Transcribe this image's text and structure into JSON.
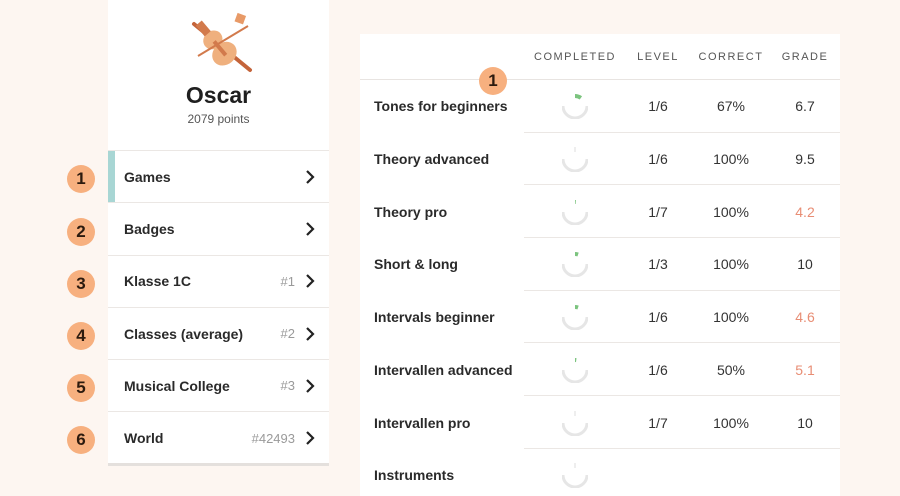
{
  "profile": {
    "name": "Oscar",
    "points": "2079 points",
    "avatar_icon": "violin-icon"
  },
  "menu": [
    {
      "label": "Games",
      "rank": "",
      "active": true
    },
    {
      "label": "Badges",
      "rank": "",
      "active": false
    },
    {
      "label": "Klasse 1C",
      "rank": "#1",
      "active": false
    },
    {
      "label": "Classes (average)",
      "rank": "#2",
      "active": false
    },
    {
      "label": "Musical College",
      "rank": "#3",
      "active": false
    },
    {
      "label": "World",
      "rank": "#42493",
      "active": false
    }
  ],
  "steps": [
    "1",
    "2",
    "3",
    "4",
    "5",
    "6"
  ],
  "table_step": "1",
  "table": {
    "headers": {
      "completed": "COMPLETED",
      "level": "LEVEL",
      "correct": "CORRECT",
      "grade": "GRADE"
    },
    "rows": [
      {
        "name": "Tones for beginners",
        "completed_fraction": 0.1,
        "level": "1/6",
        "correct": "67%",
        "grade": "6.7",
        "grade_low": false
      },
      {
        "name": "Theory advanced",
        "completed_fraction": 0.0,
        "level": "1/6",
        "correct": "100%",
        "grade": "9.5",
        "grade_low": false
      },
      {
        "name": "Theory pro",
        "completed_fraction": 0.01,
        "level": "1/7",
        "correct": "100%",
        "grade": "4.2",
        "grade_low": true
      },
      {
        "name": "Short & long",
        "completed_fraction": 0.05,
        "level": "1/3",
        "correct": "100%",
        "grade": "10",
        "grade_low": false
      },
      {
        "name": "Intervals beginner",
        "completed_fraction": 0.05,
        "level": "1/6",
        "correct": "100%",
        "grade": "4.6",
        "grade_low": true
      },
      {
        "name": "Intervallen advanced",
        "completed_fraction": 0.02,
        "level": "1/6",
        "correct": "50%",
        "grade": "5.1",
        "grade_low": true
      },
      {
        "name": "Intervallen pro",
        "completed_fraction": 0.0,
        "level": "1/7",
        "correct": "100%",
        "grade": "10",
        "grade_low": false
      },
      {
        "name": "Instruments",
        "completed_fraction": 0.0,
        "level": "",
        "correct": "",
        "grade": "",
        "grade_low": false
      }
    ]
  },
  "colors": {
    "accent_teal": "#a8d6d4",
    "badge_orange": "#f7b07f",
    "progress_green": "#7cc47f",
    "grade_low": "#e88d74"
  }
}
